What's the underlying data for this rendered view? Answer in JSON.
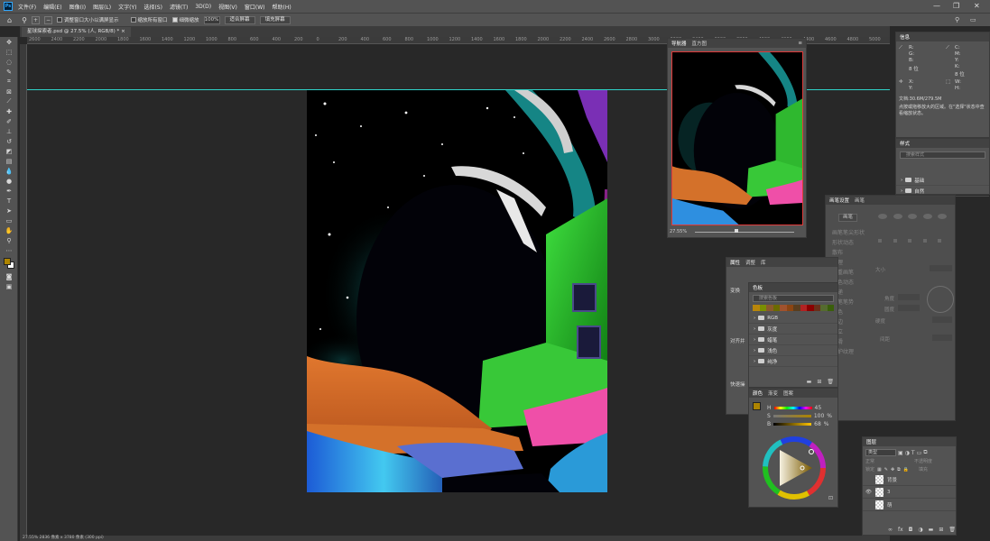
{
  "menubar": {
    "logo": "Ps",
    "items": [
      "文件(F)",
      "编辑(E)",
      "图像(I)",
      "图层(L)",
      "文字(Y)",
      "选择(S)",
      "滤镜(T)",
      "3D(D)",
      "视图(V)",
      "窗口(W)",
      "帮助(H)"
    ],
    "window_controls": [
      "—",
      "❐",
      "✕"
    ]
  },
  "options": {
    "resize_windows": "调整窗口大小以满屏显示",
    "zoom_all": "缩放所有窗口",
    "scrubby_zoom": "细微缩放",
    "zoom_value": "100%",
    "fit_screen": "适合屏幕",
    "fill_screen": "填充屏幕"
  },
  "document_tab": {
    "label": "星球探索者.psd @ 27.5% (人, RGB/8) *",
    "close": "×"
  },
  "ruler": {
    "h_ticks": [
      "2600",
      "2400",
      "2200",
      "2000",
      "1800",
      "1600",
      "1400",
      "1200",
      "1000",
      "800",
      "600",
      "400",
      "200",
      "0",
      "200",
      "400",
      "600",
      "800",
      "1000",
      "1200",
      "1400",
      "1600",
      "1800",
      "2000",
      "2200",
      "2400",
      "2600",
      "2800",
      "3000",
      "3200",
      "3400",
      "3600",
      "3800",
      "4000",
      "4200",
      "4400",
      "4600",
      "4800",
      "5000",
      "5200"
    ]
  },
  "status_bar": "27.55%   2836 像素 x 3780 像素 (300 ppi)",
  "navigator": {
    "tabs": [
      "导航器",
      "直方图"
    ],
    "zoom": "27.55%"
  },
  "info_panel": {
    "title": "信息",
    "rgb": [
      "R:",
      "G:",
      "B:"
    ],
    "cmyk": [
      "C:",
      "M:",
      "Y:",
      "K:"
    ],
    "bits_left": "8 位",
    "bits_right": "8 位",
    "xy": [
      "X:",
      "Y:"
    ],
    "wh": [
      "W:",
      "H:"
    ],
    "doc_size": "文档:30.6M/279.5M",
    "hint": "点按或拖移放大的区域。在\"选择\"状态中查看缩放状态。"
  },
  "styles_panel": {
    "title": "样式",
    "search": "搜索样式",
    "groups": [
      "基础",
      "自然"
    ]
  },
  "brush_settings": {
    "tabs": [
      "画笔设置",
      "画笔"
    ],
    "button": "画笔",
    "rows": [
      "画笔笔尖形状",
      "形状动态",
      "散布",
      "纹理",
      "双重画笔",
      "颜色动态",
      "传递",
      "画笔笔势",
      "杂色",
      "湿边",
      "建立",
      "平滑",
      "保护纹理"
    ],
    "size_label": "大小",
    "angle_label": "角度",
    "roundness_label": "圆度",
    "hardness_label": "硬度",
    "spacing_label": "间距"
  },
  "properties_panel": {
    "tabs": [
      "属性",
      "调整",
      "库"
    ],
    "sections": [
      "变换",
      "对齐并",
      "快速操"
    ]
  },
  "swatches_panel": {
    "tabs": [
      "色板"
    ],
    "search": "搜索色板",
    "folders": [
      "RGB",
      "灰度",
      "蜡笔",
      "浅色",
      "纯净"
    ],
    "recent_colors": [
      "#b8860b",
      "#7a8f00",
      "#8b5a2b",
      "#6b6b00",
      "#a0522d",
      "#8b4513",
      "#5a3d1e",
      "#b22222",
      "#8b0000",
      "#6b2f1a",
      "#556b2f",
      "#3a5f0b"
    ]
  },
  "color_panel": {
    "tabs": [
      "颜色",
      "渐变",
      "图案"
    ],
    "h_label": "H",
    "s_label": "S",
    "b_label": "B",
    "h_value": "45",
    "s_value": "100",
    "b_value": "68",
    "percent": "%",
    "foreground": "#ad8400"
  },
  "layers_panel": {
    "title": "图层",
    "filter": "类型",
    "mode": "正常",
    "opacity_label": "不透明度",
    "lock_label": "锁定",
    "fill_label": "填充",
    "layers": [
      "背景",
      "3",
      "萌"
    ]
  },
  "colors": {
    "ps_bg": "#282828",
    "panel": "#535353",
    "guide": "#2fd3c9"
  }
}
